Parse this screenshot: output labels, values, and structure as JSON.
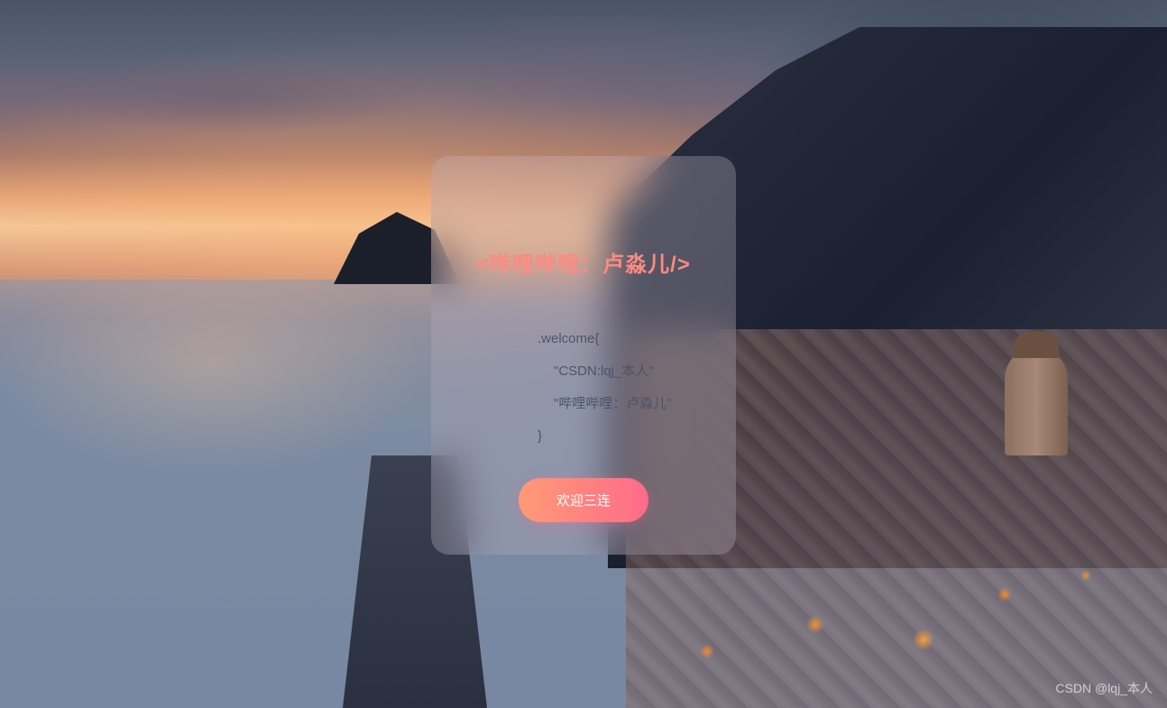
{
  "card": {
    "title": "<哔哩哔哩：卢淼儿/>",
    "code": {
      "open": ".welcome{",
      "line1": "\"CSDN:lqj_本人\"",
      "line2": "\"哔哩哔哩：卢淼儿\"",
      "close": "}"
    },
    "button_label": "欢迎三连"
  },
  "watermark": "CSDN @lqj_本人"
}
